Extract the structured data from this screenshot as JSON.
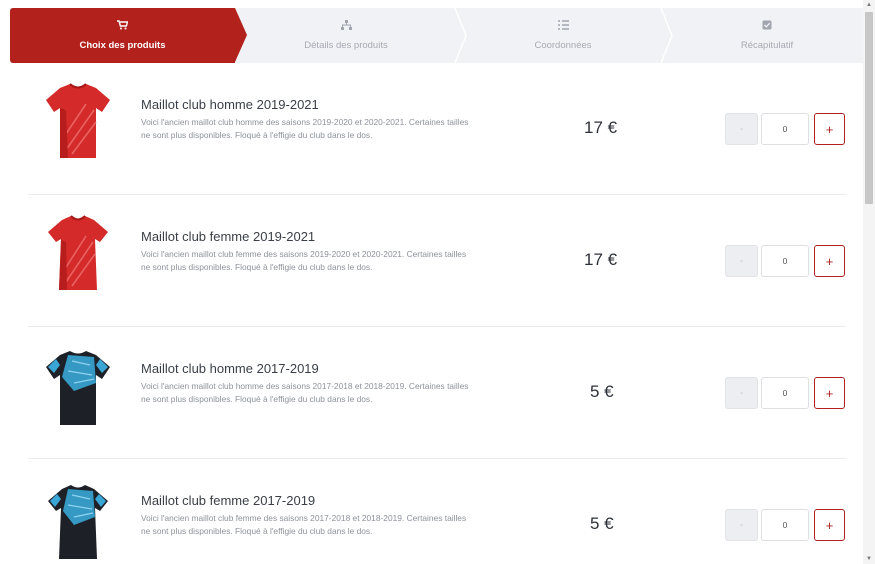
{
  "steps": [
    {
      "label": "Choix des produits",
      "icon": "cart-icon",
      "active": true
    },
    {
      "label": "Détails des produits",
      "icon": "sitemap-icon",
      "active": false
    },
    {
      "label": "Coordonnées",
      "icon": "list-icon",
      "active": false
    },
    {
      "label": "Récapitulatif",
      "icon": "check-square-icon",
      "active": false
    }
  ],
  "products": [
    {
      "name": "Maillot club homme 2019-2021",
      "description": "Voici l'ancien maillot club homme des saisons 2019-2020 et 2020-2021. Certaines tailles ne sont plus disponibles. Floqué à l'effigie du club dans le dos.",
      "price": "17 €",
      "quantity": "0",
      "minus": "-",
      "plus": "+",
      "jersey": "red-jersey"
    },
    {
      "name": "Maillot club femme 2019-2021",
      "description": "Voici l'ancien maillot club femme des saisons 2019-2020 et 2020-2021. Certaines tailles ne sont plus disponibles. Floqué à l'effigie du club dans le dos.",
      "price": "17 €",
      "quantity": "0",
      "minus": "-",
      "plus": "+",
      "jersey": "red-jersey"
    },
    {
      "name": "Maillot club homme 2017-2019",
      "description": "Voici l'ancien maillot club homme des saisons 2017-2018 et 2018-2019. Certaines tailles ne sont plus disponibles. Floqué à l'effigie du club dans le dos.",
      "price": "5 €",
      "quantity": "0",
      "minus": "-",
      "plus": "+",
      "jersey": "black-blue-jersey"
    },
    {
      "name": "Maillot club femme 2017-2019",
      "description": "Voici l'ancien maillot club femme des saisons 2017-2018 et 2018-2019. Certaines tailles ne sont plus disponibles. Floqué à l'effigie du club dans le dos.",
      "price": "5 €",
      "quantity": "0",
      "minus": "-",
      "plus": "+",
      "jersey": "black-blue-jersey"
    }
  ],
  "colors": {
    "accent": "#b2211c",
    "steps_bg": "#f1f2f5",
    "jersey_red": "#d42a2a",
    "jersey_black": "#1d2127",
    "jersey_blue": "#3aa6d6"
  },
  "scrollbar": {
    "up": "▲",
    "down": "▼"
  }
}
